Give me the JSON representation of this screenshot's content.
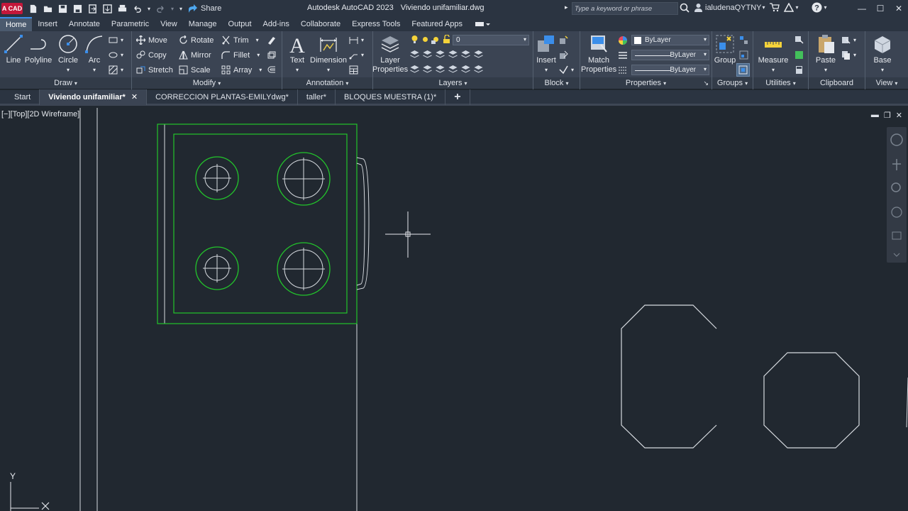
{
  "app": {
    "logo": "A CAD",
    "title_app": "Autodesk AutoCAD 2023",
    "title_file": "Viviendo unifamiliar.dwg",
    "share_label": "Share",
    "search_placeholder": "Type a keyword or phrase",
    "user": "ialudenaQYTNY"
  },
  "ribbon_tabs": [
    "Home",
    "Insert",
    "Annotate",
    "Parametric",
    "View",
    "Manage",
    "Output",
    "Add-ins",
    "Collaborate",
    "Express Tools",
    "Featured Apps"
  ],
  "draw": {
    "title": "Draw",
    "line": "Line",
    "polyline": "Polyline",
    "circle": "Circle",
    "arc": "Arc"
  },
  "modify": {
    "title": "Modify",
    "move": "Move",
    "rotate": "Rotate",
    "trim": "Trim",
    "copy": "Copy",
    "mirror": "Mirror",
    "fillet": "Fillet",
    "stretch": "Stretch",
    "scale": "Scale",
    "array": "Array"
  },
  "annotation": {
    "title": "Annotation",
    "text": "Text",
    "dimension": "Dimension"
  },
  "layers": {
    "title": "Layers",
    "layer_properties_1": "Layer",
    "layer_properties_2": "Properties",
    "current_layer": "0"
  },
  "block": {
    "title": "Block",
    "insert": "Insert"
  },
  "properties": {
    "title": "Properties",
    "match_1": "Match",
    "match_2": "Properties",
    "color": "ByLayer",
    "linetype": "ByLayer",
    "lineweight": "ByLayer"
  },
  "groups": {
    "title": "Groups",
    "group": "Group"
  },
  "utilities": {
    "title": "Utilities",
    "measure": "Measure"
  },
  "clipboard": {
    "title": "Clipboard",
    "paste": "Paste"
  },
  "view_panel": {
    "title": "View",
    "base": "Base"
  },
  "doc_tabs": [
    {
      "label": "Start"
    },
    {
      "label": "Viviendo unifamiliar*"
    },
    {
      "label": "CORRECCION PLANTAS-EMILYdwg*"
    },
    {
      "label": "taller*"
    },
    {
      "label": "BLOQUES MUESTRA (1)*"
    }
  ],
  "viewport": {
    "label": "[−][Top][2D Wireframe]",
    "ucs_y": "Y"
  },
  "colors": {
    "background": "#212830",
    "ribbon": "#3b4453",
    "entity_green": "#22c52b",
    "entity_white": "#d7dbe0",
    "accent": "#3b8eea"
  }
}
